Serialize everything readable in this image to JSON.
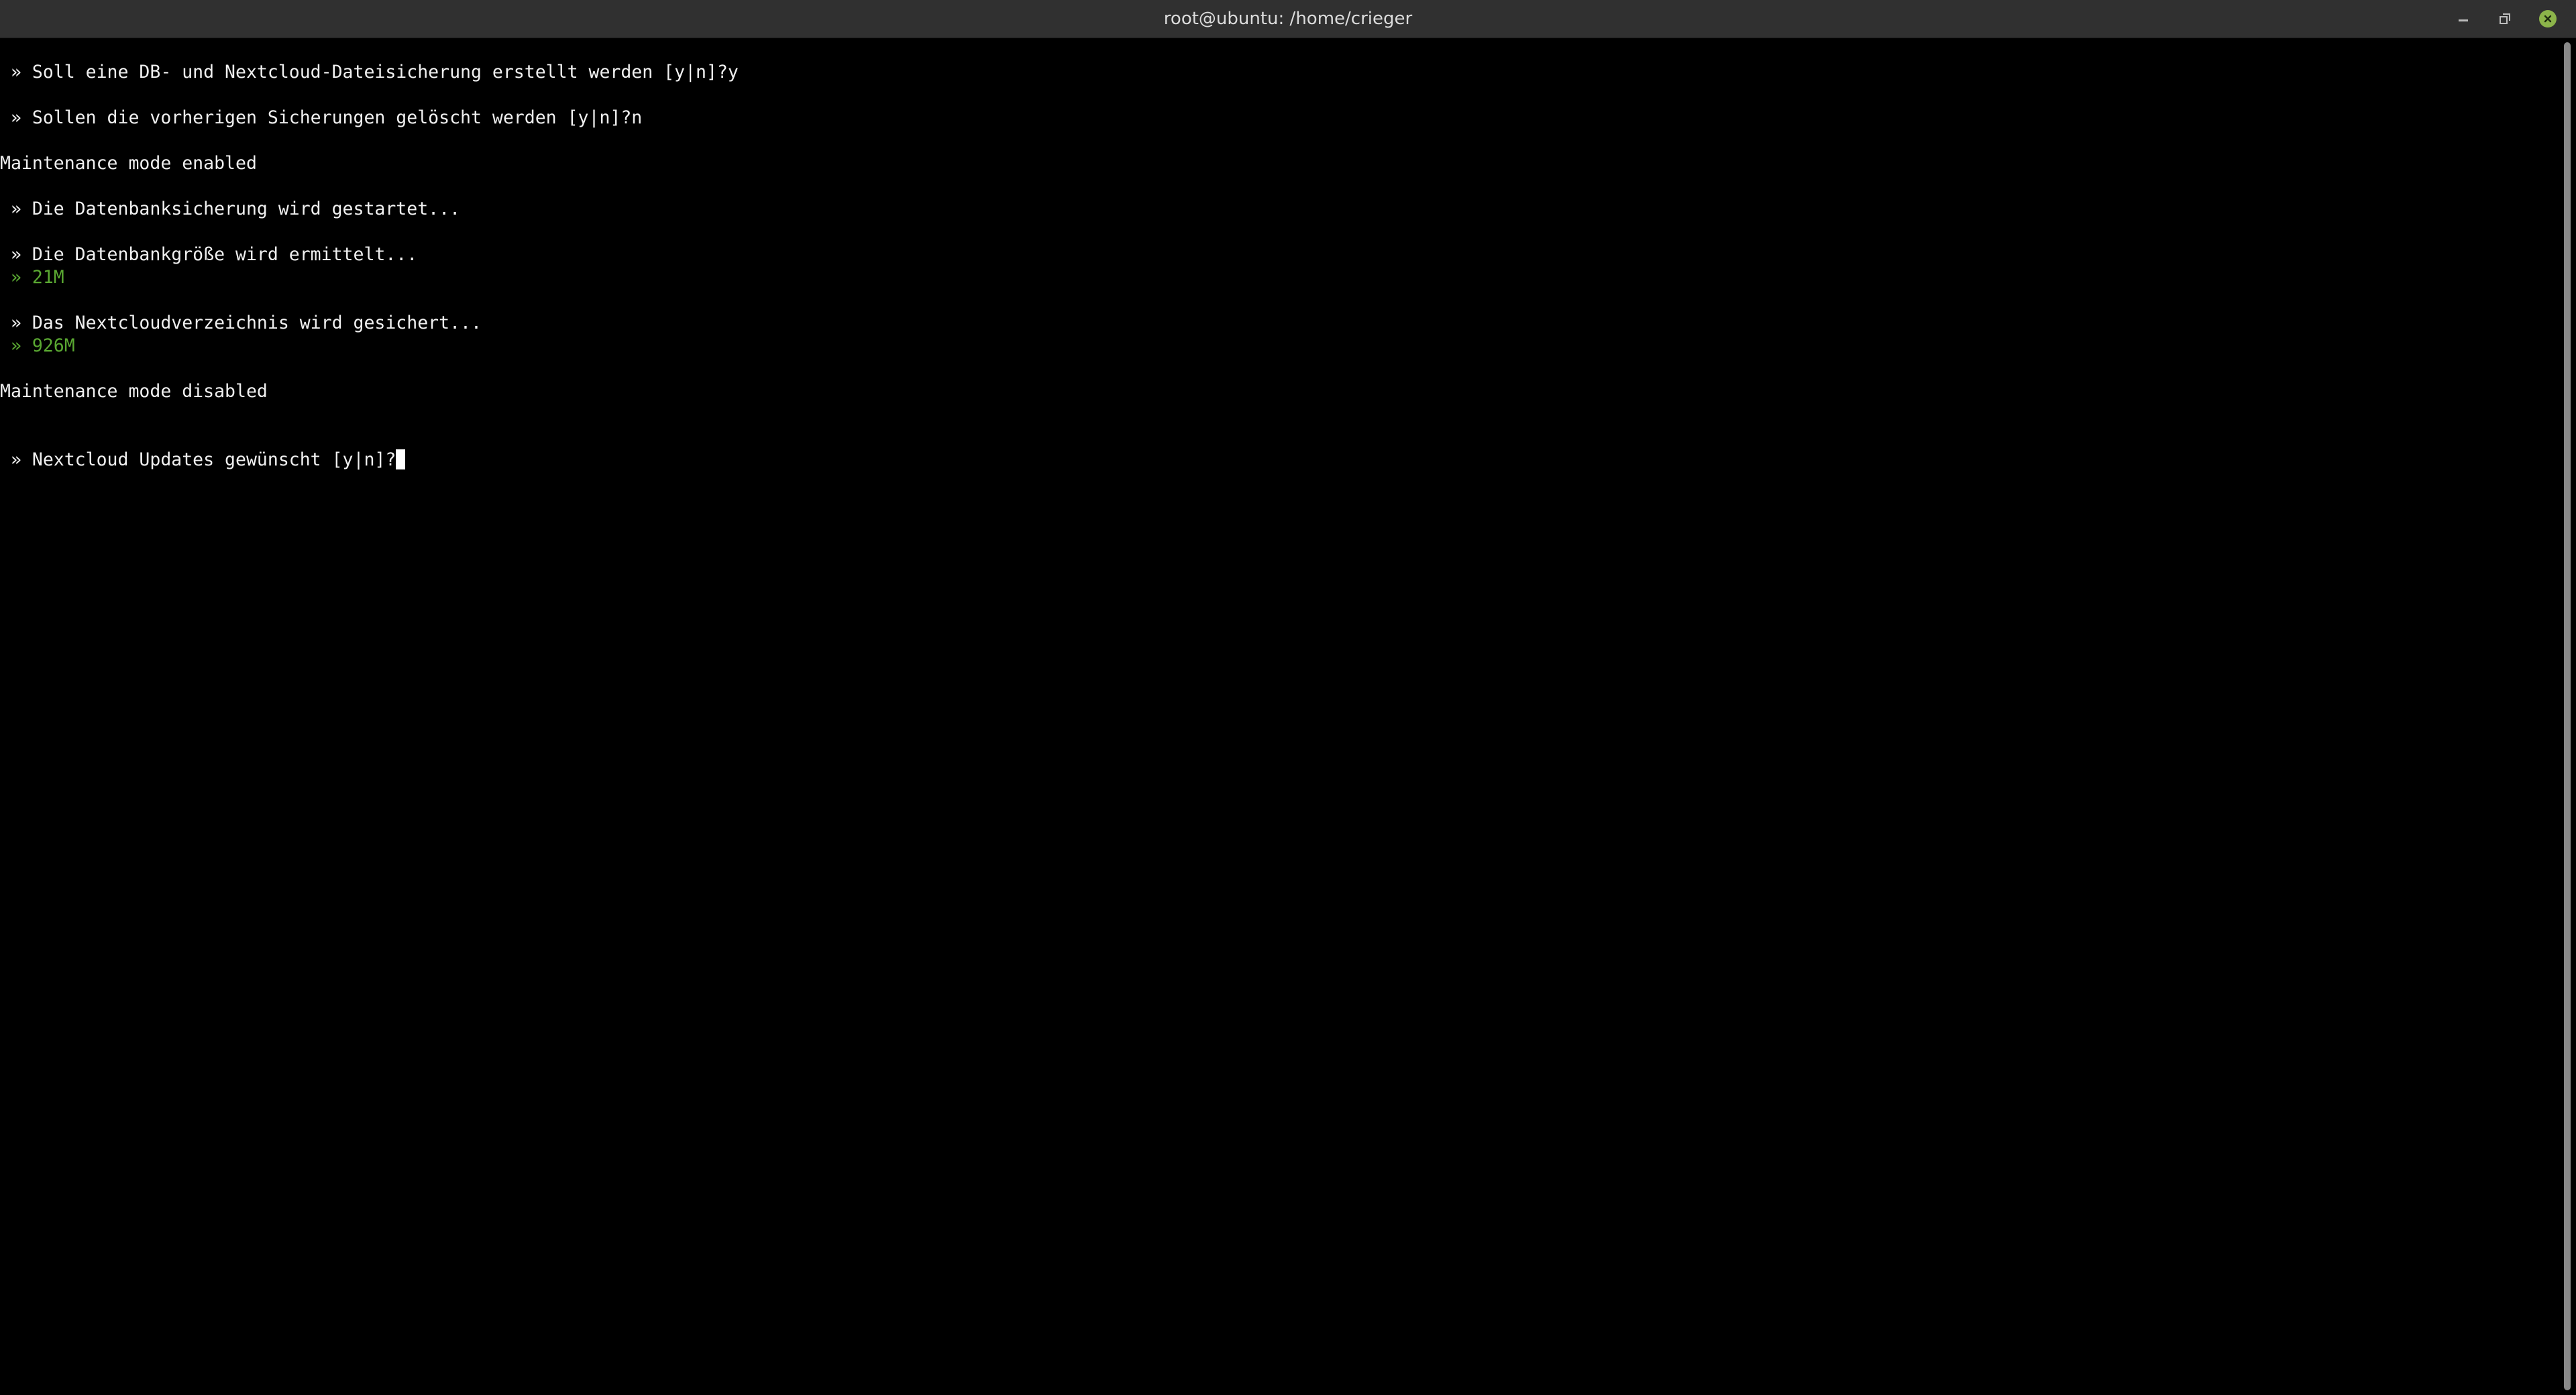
{
  "window": {
    "title": "root@ubuntu: /home/crieger",
    "controls": {
      "minimize": "minimize-icon",
      "maximize": "restore-icon",
      "close": "close-icon"
    },
    "colors": {
      "titlebar": "#303030",
      "close_button": "#8cb44a",
      "terminal_bg": "#000000",
      "text": "#f0f0f0",
      "green_text": "#5aa832"
    }
  },
  "terminal": {
    "lines": [
      {
        "text": " » Soll eine DB- und Nextcloud-Dateisicherung erstellt werden [y|n]?y",
        "color": "default"
      },
      {
        "text": " » Sollen die vorherigen Sicherungen gelöscht werden [y|n]?n",
        "color": "default"
      },
      {
        "text": "Maintenance mode enabled",
        "color": "default"
      },
      {
        "text": " » Die Datenbanksicherung wird gestartet...",
        "color": "default"
      },
      {
        "text": " » Die Datenbankgröße wird ermittelt...",
        "color": "default"
      },
      {
        "text": " » 21M",
        "color": "green"
      },
      {
        "text": " » Das Nextcloudverzeichnis wird gesichert...",
        "color": "default"
      },
      {
        "text": " » 926M",
        "color": "green"
      },
      {
        "text": "Maintenance mode disabled",
        "color": "default"
      },
      {
        "text": " » Nextcloud Updates gewünscht [y|n]?",
        "color": "default",
        "cursor": true
      }
    ]
  }
}
